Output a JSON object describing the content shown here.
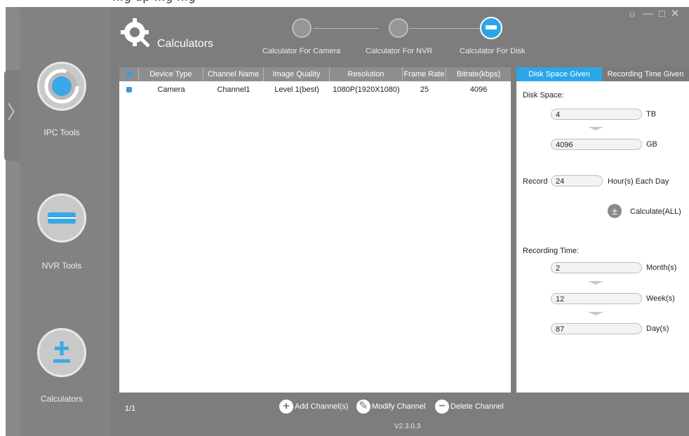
{
  "caption": "...g up ...g ...g",
  "window": {
    "title": "Calculators",
    "controls": [
      "☼",
      "—",
      "□",
      "✕"
    ]
  },
  "steps": [
    {
      "label": "Calculator For Camera"
    },
    {
      "label": "Calculator For NVR"
    },
    {
      "label": "Calculator For Disk"
    }
  ],
  "sidebar": {
    "items": [
      {
        "label": "IPC Tools",
        "icon": "ipc-tools-icon"
      },
      {
        "label": "NVR Tools",
        "icon": "nvr-tools-icon"
      },
      {
        "label": "Calculators",
        "icon": "calculator-icon"
      }
    ]
  },
  "table": {
    "headers": [
      "Device Type",
      "Channel Name",
      "Image Quality",
      "Resolution",
      "Frame Rate",
      "Bitrate(kbps)"
    ],
    "rows": [
      [
        "Camera",
        "Channel1",
        "Level 1(best)",
        "1080P(1920X1080)",
        "25",
        "4096"
      ]
    ]
  },
  "right_panel": {
    "tabs": [
      "Disk Space Given",
      "Recording Time Given"
    ],
    "disk_space_label": "Disk Space:",
    "tb_value": "4",
    "tb_unit": "TB",
    "gb_value": "4096",
    "gb_unit": "GB",
    "record_label": "Record",
    "record_value": "24",
    "record_unit": "Hour(s) Each Day",
    "calculate_label": "Calculate(ALL)",
    "recording_time_label": "Recording Time:",
    "month_value": "2",
    "month_unit": "Month(s)",
    "week_value": "12",
    "week_unit": "Week(s)",
    "day_value": "87",
    "day_unit": "Day(s)"
  },
  "footer": {
    "page": "1/1",
    "add_label": "Add Channel(s)",
    "modify_label": "Modify Channel",
    "delete_label": "Delete Channel",
    "version": "V2.3.0.3"
  },
  "colors": {
    "accent": "#2aa6e8",
    "checkbox": "#3e9cd8",
    "background": "#7d7d7d"
  }
}
